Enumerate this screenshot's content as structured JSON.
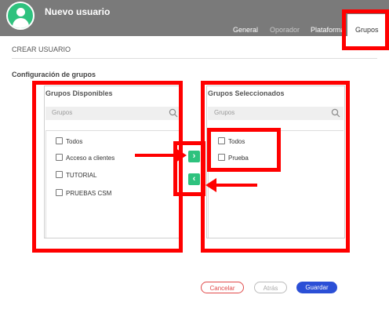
{
  "header": {
    "title": "Nuevo usuario",
    "tabs": [
      "General",
      "Oporador",
      "Plataforma",
      "Grupos"
    ]
  },
  "subtitle": "CREAR USUARIO",
  "section_title": "Configuración de grupos",
  "available": {
    "title": "Grupos Disponibles",
    "search_placeholder": "Grupos",
    "items": [
      "Todos",
      "Acceso a clientes",
      "TUTORIAL",
      "PRUEBAS CSM"
    ]
  },
  "selected": {
    "title": "Grupos Seleccionados",
    "search_placeholder": "Grupos",
    "items": [
      "Todos",
      "Prueba"
    ]
  },
  "move_buttons": {
    "add": "›",
    "remove": "‹"
  },
  "footer": {
    "cancel": "Cancelar",
    "back": "Atrás",
    "save": "Guardar"
  },
  "colors": {
    "header": "#7a7a7a",
    "accent_green": "#2ec27e",
    "annotation": "#ff0000",
    "save": "#2b4fd6",
    "cancel": "#e14b4b"
  },
  "icons": [
    "avatar-user-icon",
    "search-icon",
    "checkbox-icon",
    "chevron-right-icon",
    "chevron-left-icon",
    "arrow-right-icon",
    "arrow-left-icon"
  ]
}
